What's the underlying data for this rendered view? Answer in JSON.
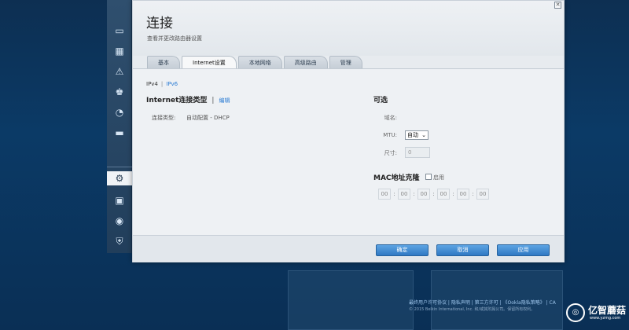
{
  "dialog": {
    "title": "连接",
    "subtitle": "查看并更改路由器设置",
    "close_glyph": "✕"
  },
  "tabs": [
    {
      "label": "基本",
      "active": false
    },
    {
      "label": "Internet设置",
      "active": true
    },
    {
      "label": "本地网络",
      "active": false
    },
    {
      "label": "高级路由",
      "active": false
    },
    {
      "label": "管理",
      "active": false
    }
  ],
  "subtabs": {
    "ipv4": "IPv4",
    "divider": "|",
    "ipv6": "IPv6"
  },
  "internet_section": {
    "title": "Internet连接类型",
    "divider": "|",
    "edit_link": "编辑",
    "connection_type_label": "连接类型:",
    "connection_type_value": "自动配置 - DHCP"
  },
  "optional_section": {
    "title": "可选",
    "domain_label": "域名:",
    "mtu_label": "MTU:",
    "mtu_value": "自动",
    "size_label": "尺寸:",
    "size_value": "0"
  },
  "mac_clone": {
    "title": "MAC地址克隆",
    "enable_label": "启用",
    "enabled": false,
    "octets": [
      "00",
      "00",
      "00",
      "00",
      "00",
      "00"
    ],
    "separator": ":"
  },
  "buttons": {
    "ok": "确定",
    "cancel": "取消",
    "apply": "应用"
  },
  "footer": {
    "links": "最终用户许可协议 | 隐私声明 | 第三方许可 | 《Ookla隐私策略》 | CA",
    "copyright": "© 2015 Belkin International, Inc. 和/或其附属公司。保留所有权利。"
  },
  "watermark": {
    "text": "亿智蘑菇",
    "sub": "www.yzmg.com"
  },
  "nav_icons": [
    "router-icon",
    "devices-icon",
    "warning-icon",
    "parental-icon",
    "speed-icon",
    "storage-icon",
    "settings-icon",
    "camera-icon",
    "wifi-icon",
    "security-icon"
  ],
  "colors": {
    "accent": "#2f78c3",
    "link": "#2a7bd3",
    "background": "#0b3a66"
  }
}
